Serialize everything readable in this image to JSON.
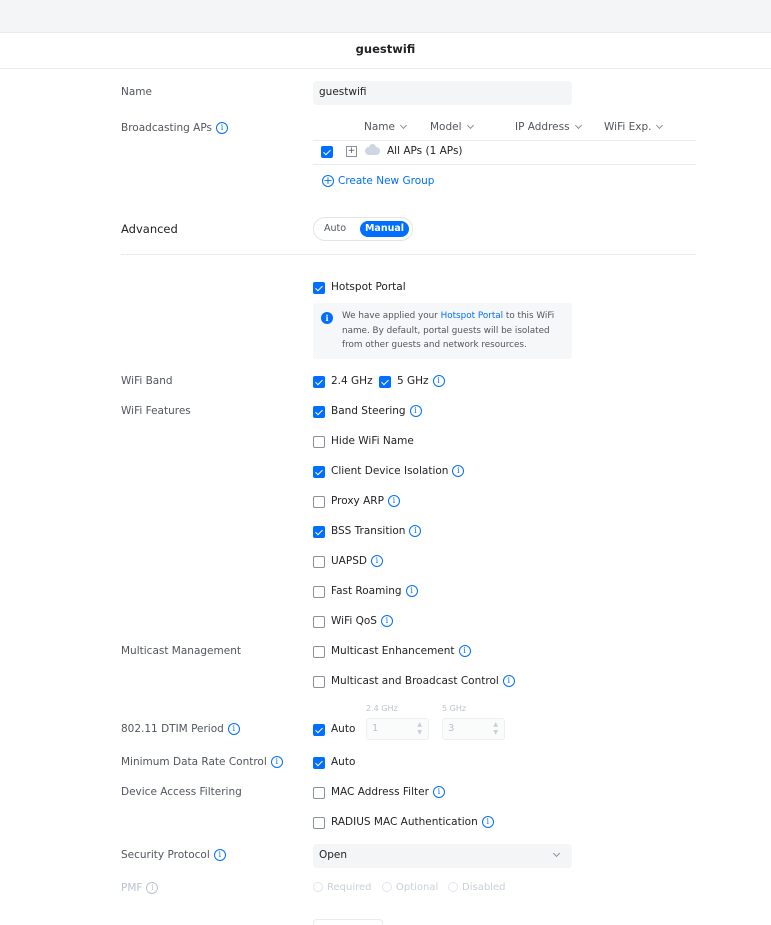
{
  "title": "guestwifi",
  "name_field": {
    "label": "Name",
    "value": "guestwifi"
  },
  "broadcasting": {
    "label": "Broadcasting APs",
    "columns": [
      "Name",
      "Model",
      "IP Address",
      "WiFi Exp."
    ],
    "row_label": "All APs (1 APs)",
    "row_checked": true,
    "create_group": "Create New Group"
  },
  "advanced": {
    "label": "Advanced",
    "options": [
      "Auto",
      "Manual"
    ],
    "selected": "Manual"
  },
  "hotspot": {
    "label": "Hotspot Portal",
    "checked": true,
    "notice_pre": "We have applied your",
    "notice_link": "Hotspot Portal",
    "notice_post": "to this WiFi name. By default, portal guests will be isolated from other guests and network resources."
  },
  "wifi_band": {
    "label": "WiFi Band",
    "option_24": "2.4 GHz",
    "option_5": "5 GHz",
    "checked_24": true,
    "checked_5": true
  },
  "wifi_features": {
    "label": "WiFi Features",
    "items": [
      {
        "label": "Band Steering",
        "checked": true
      },
      {
        "label": "Hide WiFi Name",
        "checked": false
      },
      {
        "label": "Client Device Isolation",
        "checked": true
      },
      {
        "label": "Proxy ARP",
        "checked": false
      },
      {
        "label": "BSS Transition",
        "checked": true
      },
      {
        "label": "UAPSD",
        "checked": false
      },
      {
        "label": "Fast Roaming",
        "checked": false
      },
      {
        "label": "WiFi QoS",
        "checked": false
      }
    ]
  },
  "multicast": {
    "label": "Multicast Management",
    "items": [
      {
        "label": "Multicast Enhancement",
        "checked": false
      },
      {
        "label": "Multicast and Broadcast Control",
        "checked": false
      }
    ]
  },
  "dtim": {
    "label": "802.11 DTIM Period",
    "auto_label": "Auto",
    "auto_checked": true,
    "band_24_label": "2.4 GHz",
    "band_24_value": "1",
    "band_5_label": "5 GHz",
    "band_5_value": "3"
  },
  "min_rate": {
    "label": "Minimum Data Rate Control",
    "auto_label": "Auto",
    "auto_checked": true
  },
  "device_access": {
    "label": "Device Access Filtering",
    "items": [
      {
        "label": "MAC Address Filter",
        "checked": false
      },
      {
        "label": "RADIUS MAC Authentication",
        "checked": false
      }
    ]
  },
  "security": {
    "label": "Security Protocol",
    "value": "Open"
  },
  "pmf": {
    "label": "PMF",
    "options": [
      "Required",
      "Optional",
      "Disabled"
    ]
  },
  "colors": {
    "accent": "#006fff",
    "text": "#212327",
    "label": "#50565e",
    "disabled": "#b9c3d3",
    "input_bg": "#f4f5f6"
  },
  "icons": [
    "info-icon",
    "chevron-down-icon",
    "plus-circle-icon",
    "expand-icon",
    "ap-cloud-icon",
    "checkbox-icon"
  ]
}
